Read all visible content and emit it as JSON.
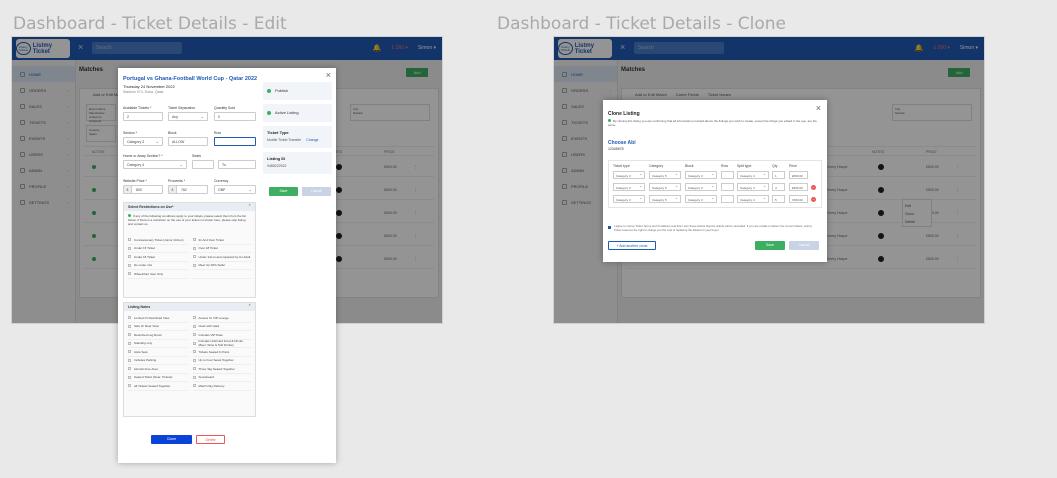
{
  "left_title": "Dashboard - Ticket Details - Edit",
  "right_title": "Dashboard - Ticket Details - Clone",
  "app": {
    "logo_text": "Listmy Tickets",
    "brand": "Listmy Ticket",
    "search_placeholder": "Search",
    "balance": "£ 260",
    "user": "Simon",
    "sidebar": [
      {
        "label": "HOME",
        "active": true
      },
      {
        "label": "ORDERS"
      },
      {
        "label": "SALES"
      },
      {
        "label": "TICKETS"
      },
      {
        "label": "EVENTS"
      },
      {
        "label": "USERS"
      },
      {
        "label": "ADMIN"
      },
      {
        "label": "PROFILE"
      },
      {
        "label": "SETTINGS"
      }
    ],
    "page_title": "Matches",
    "add_button": "Add",
    "tabs": [
      "Add or Edit Match",
      "Carter Fields",
      "Ticket Issues"
    ],
    "event_name_label": "Event Name",
    "event_name_value": "Manchester United vs Liverpool",
    "city_label": "City",
    "city_value": "Nazaré",
    "country_label": "Country",
    "country_value": "Spain",
    "columns": [
      "ACTIVE",
      "NOTES",
      "PRICE"
    ],
    "rows": [
      {
        "name": "Emery Hoque",
        "price": "£500.00"
      },
      {
        "name": "Emery Hoque",
        "price": "£500.00"
      },
      {
        "name": "Emery Hoque",
        "price": "£500.00"
      },
      {
        "name": "Emery Hoque",
        "price": "£500.00"
      },
      {
        "name": "Emery Hoque",
        "price": "£500.00"
      }
    ],
    "row_menu": [
      "Edit",
      "Clone",
      "Delete"
    ],
    "bottom_rows": [
      {
        "name": "Emery Hoque",
        "price": "£500.00"
      },
      {
        "name": "Emery Hoque",
        "price": "£500.00"
      }
    ]
  },
  "edit": {
    "title": "Portugal vs Ghana-Football World Cup - Qatar 2022",
    "date": "Thursday 24 November 2022",
    "venue": "Stadium 974, Doha, Qatar",
    "available_tickets_label": "Available Tickets *",
    "available_tickets": "2",
    "ticket_separation_label": "Ticket Separation",
    "ticket_separation": "Any",
    "quantity_sold_label": "Quantity Sold",
    "quantity_sold": "0",
    "section_label": "Section *",
    "section": "Category 3",
    "block_label": "Block",
    "block": "ALLOW",
    "row_label": "Row",
    "row": "",
    "home_away_label": "Home or Away Section? *",
    "home_away": "Category 4",
    "seats_label": "Seats",
    "seats": "To",
    "website_price_label": "Website Price *",
    "website_price": "800",
    "proceeds_label": "Proceeds *",
    "proceeds": "762",
    "currency_label": "Currency",
    "currency": "GBP",
    "publish": "Publish",
    "active_listing": "Active Listing",
    "ticket_type_label": "Ticket Type",
    "ticket_type": "Mobile Ticket Transfer",
    "change": "Change",
    "listing_id_label": "Listing ID",
    "listing_id": "9488222522",
    "save": "Save",
    "cancel": "Cancel",
    "restrictions_title": "Select Restrictions on Use*",
    "restrictions_note": "If any of the following conditions apply to your tickets, please select them from the list below. If there is a restriction on the use of your ticket not shown here, please stop listing and contact us.",
    "restrictions": [
      "Concessionary Ticket (Junior Citizen)",
      "21 And Over Ticket",
      "Under 15 Ticket",
      "Over 18 Ticket",
      "Under 18 Ticket",
      "Under 14s to accompanied by An Adult",
      "No under 14s",
      "Meet Up With Seller",
      "Wheelchair User Only",
      ""
    ],
    "notes_title": "Listing Notes",
    "notes": [
      "Limited Or Restricted View",
      "Access To VIP Lounge",
      "Side Or Rear View",
      "Clear with Hard",
      "Restricted Leg Room",
      "Includes VIP Pass",
      "Standing only",
      "Includes Unlimited Food & Drinks (Beer, Wine & Soft Drinks)",
      "Aisle Seat",
      "Tickets Seated In Pairs",
      "Includes Parking",
      "Up to Four Seats Together",
      "Alcohol Free Area",
      "Three Tag Seated Together",
      "Seated Ticket (Note: Tickets)",
      "Scoreboard",
      "All Tickets Seated Together",
      "Match Day Delivery"
    ],
    "clone_button": "Clone",
    "delete_button": "Delete"
  },
  "clone": {
    "title": "Clone Listing",
    "note": "By cloning this listing you are confirming that all information provided above the listings you wish to create, except the things you edited in the eye, are the same.",
    "section_title": "Choose Abi",
    "section_id": "12345678",
    "headers": [
      "Ticket type",
      "Category",
      "Block",
      "Row",
      "Split type",
      "Qty",
      "Price"
    ],
    "rows": [
      {
        "type": "Category 3",
        "category": "Category 5",
        "block": "Category 3",
        "split": "Category 4",
        "qty": "1",
        "price": "£500.00",
        "remove": false
      },
      {
        "type": "Category 3",
        "category": "Category 5",
        "block": "Category 3",
        "split": "Category 4",
        "qty": "4",
        "price": "£500.00",
        "remove": true
      },
      {
        "type": "Category 3",
        "category": "Category 5",
        "block": "Category 3",
        "split": "Category 4",
        "qty": "5",
        "price": "1500.00",
        "remove": true
      }
    ],
    "agree": "I agree to Listmy Ticket Terms and Conditions and that I own these tickets that the tickets will be cancelled. If you are unable to deliver the correct tickets, Listmy Ticket reserves the right to charge you the cost of replacing the tickets for your buyer.",
    "add_another": "+ Add another clone",
    "save": "Save",
    "cancel": "Cancel"
  },
  "colors": {
    "brand": "#1f5bb4",
    "accent": "#3dae62",
    "danger": "#e55555"
  }
}
